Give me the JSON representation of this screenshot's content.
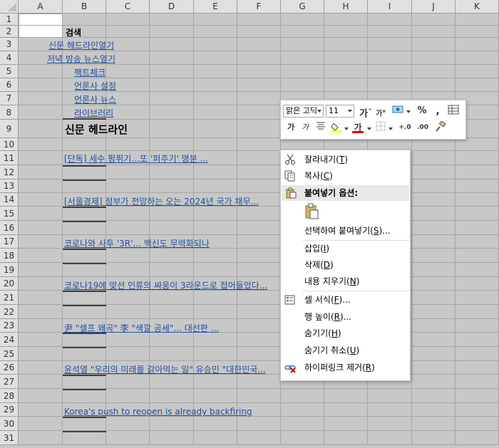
{
  "sheet": {
    "columns": [
      "A",
      "B",
      "C",
      "D",
      "E",
      "F",
      "G",
      "H",
      "I",
      "J",
      "K"
    ],
    "rows": [
      "1",
      "2",
      "3",
      "4",
      "5",
      "6",
      "7",
      "8",
      "9",
      "10",
      "11",
      "12",
      "13",
      "14",
      "15",
      "16",
      "17",
      "18",
      "19",
      "20",
      "21",
      "22",
      "23",
      "24",
      "25",
      "26",
      "27",
      "28",
      "29",
      "30",
      "31"
    ],
    "cells": {
      "b2": "검색",
      "a3": "신문 헤드라인열기",
      "a4": "저녁 방송 뉴스열기",
      "b5": "팩트체크",
      "b6": "언론사 설정",
      "b7": "언론사 뉴스",
      "b8": "라이브러리",
      "b9": "신문 헤드라인",
      "b11": "[단독] 세수 펑퓌기…또 '퍼주기' 명분 ...",
      "b14": "[서울경제] 정부가 전망하는 오는 2024년 국가 채무...",
      "b17": "코로나와 사투 '3R'... 백신도 무력화되나",
      "b20": "코로나19에 맞선 인류의 싸움이 3라운드로 접어들었다...",
      "b23": "尹 \"셀프 왜곡\" 李 \"색깔 공세\"... 대선판 ...",
      "b26": "윤석열 \"우리의 미래를 갉아먹는 일\" 유승민 \"대한민국...",
      "b29": "Korea's push to reopen is already backfiring"
    }
  },
  "mini_toolbar": {
    "font_name": "맑은 고딕",
    "font_size": "11",
    "grow_font": "가",
    "shrink_font": "가",
    "percent": "%",
    "comma": ",",
    "bold": "가",
    "italic": "가",
    "font_color_letter": "가",
    "dec_increase": "+.0",
    "dec_decrease": ".00",
    "colors": {
      "highlight": "#ffff00",
      "font": "#e00000",
      "accent": "#217346"
    }
  },
  "context_menu": {
    "cut": "잘라내기",
    "cut_key": "T",
    "copy": "복사",
    "copy_key": "C",
    "paste_options": "붙여넣기 옵션:",
    "paste_special": "선택하여 붙여넣기",
    "paste_special_key": "S",
    "insert": "삽입",
    "insert_key": "I",
    "delete": "삭제",
    "delete_key": "D",
    "clear": "내용 지우기",
    "clear_key": "N",
    "format_cells": "셀 서식",
    "format_cells_key": "F",
    "row_height": "행 높이",
    "row_height_key": "R",
    "hide": "숨기기",
    "hide_key": "H",
    "unhide": "숨기기 취소",
    "unhide_key": "U",
    "remove_hyperlink": "하이퍼링크 제거",
    "remove_hyperlink_key": "R"
  }
}
